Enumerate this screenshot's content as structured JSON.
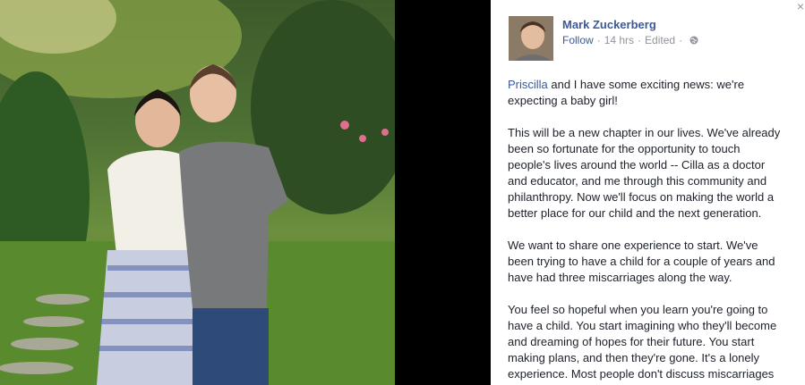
{
  "viewer": {
    "close_glyph": "×"
  },
  "post": {
    "author": "Mark Zuckerberg",
    "follow_label": "Follow",
    "time": "14 hrs",
    "edited_label": "Edited",
    "privacy_icon": "globe-icon",
    "mention": "Priscilla",
    "paragraph1_rest": " and I have some exciting news: we're expecting a baby girl!",
    "paragraph2": "This will be a new chapter in our lives. We've already been so fortunate for the opportunity to touch people's lives around the world -- Cilla as a doctor and educator, and me through this community and philanthropy. Now we'll focus on making the world a better place for our child and the next generation.",
    "paragraph3": "We want to share one experience to start. We've been trying to have a child for a couple of years and have had three miscarriages along the way.",
    "paragraph4": "You feel so hopeful when you learn you're going to have a child. You start imagining who they'll become and dreaming of hopes for their future. You start making plans, and then they're gone. It's a lonely experience. Most people don't discuss miscarriages"
  },
  "colors": {
    "link": "#3b5998",
    "meta": "#90949c",
    "text": "#1d2129"
  }
}
